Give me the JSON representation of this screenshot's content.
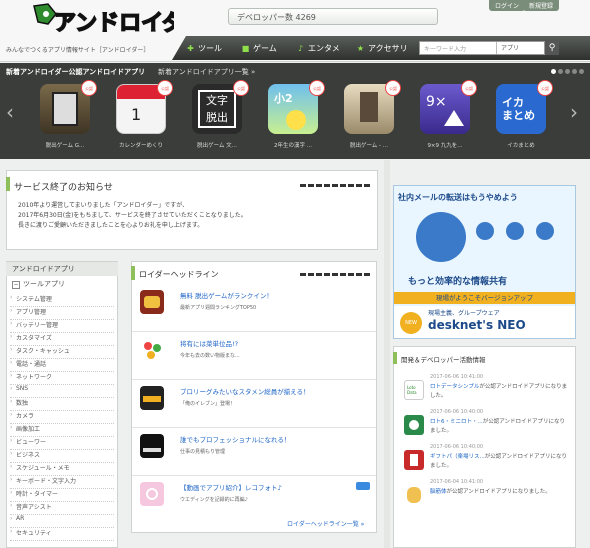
{
  "header": {
    "tagline": "みんなでつくるアプリ情報サイト［アンドロイダー］",
    "developer_count": "デベロッパー数 4269",
    "login": "ログイン",
    "register": "新規登録",
    "nav": [
      {
        "label": "ツール",
        "icon": "wrench-icon"
      },
      {
        "label": "ゲーム",
        "icon": "gamepad-icon"
      },
      {
        "label": "エンタメ",
        "icon": "music-icon"
      },
      {
        "label": "アクセサリ",
        "icon": "star-icon"
      }
    ],
    "search_placeholder": "キーワード入力",
    "search_category": "アプリ"
  },
  "carousel": {
    "title": "新着アンドロイダー公認アンドロイドアプリ",
    "link": "新着アンドロイドアプリ一覧 »",
    "apps": [
      {
        "name": "脱出ゲーム G...",
        "badge": "公認"
      },
      {
        "name": "カレンダーめくり",
        "badge": "公認"
      },
      {
        "name": "脱出ゲーム 文...",
        "badge": "公認"
      },
      {
        "name": "2年生の漢字 ...",
        "badge": "公認"
      },
      {
        "name": "脱出ゲーム - ...",
        "badge": "公認"
      },
      {
        "name": "9×9 九九を...",
        "badge": "公認"
      },
      {
        "name": "イカまとめ",
        "badge": "公認"
      }
    ]
  },
  "notice": {
    "title": "サービス終了のお知らせ",
    "lines": [
      "2010年より運営してまいりました「アンドロイダー」ですが、",
      "2017年6月30日(金)をもちまして、サービスを終了させていただくことなりました。",
      "長きに渡りご愛顧いただきましたことを心よりお礼を申し上げます。"
    ]
  },
  "ad": {
    "line1": "社内メールの転送はもうやめよう",
    "line2": "もっと効率的な情報共有",
    "line3": "現場がようこそバージョンアップ",
    "line4": "現場主義、グループウェア",
    "product": "desknet's NEO",
    "new_badge": "NEW"
  },
  "sidebar": {
    "title": "アンドロイドアプリ",
    "sub": "ツールアプリ",
    "items": [
      "システム管理",
      "アプリ管理",
      "バッテリー管理",
      "カスタマイズ",
      "タスク・キャッシュ",
      "電話・通話",
      "ネットワーク",
      "SNS",
      "数独",
      "カメラ",
      "画像加工",
      "ビューワー",
      "ビジネス",
      "スケジュール・メモ",
      "キーボード・文字入力",
      "時計・タイマー",
      "音声アシスト",
      "AR",
      "セキュリティ"
    ]
  },
  "headline": {
    "title": "ロイダーヘッドライン",
    "items": [
      {
        "title": "無料 脱出ゲームがランクイン！",
        "sub": "最新アプリ週間ランキングTOP50"
      },
      {
        "title": "将有には菜単位品!?",
        "sub": "今年も去の数い物版まな..."
      },
      {
        "title": "ブロリーグみたいなスタメン総員が揃える！",
        "sub": "「俺のイレブン」登場！"
      },
      {
        "title": "誰でもプロフェッショナルになれる！",
        "sub": "仕事の見積もり管理"
      },
      {
        "title": "【動画でアプリ紹介】レコフォト♪",
        "sub": "ウエディングを記録的に再編♪"
      }
    ],
    "more": "ロイダーヘッドライン一覧 »"
  },
  "dev": {
    "title": "開発＆デベロッパー活動情報",
    "items": [
      {
        "date": "2017-06-06 10:41:00",
        "app": "ロトデータシンプル",
        "text": "が公認アンドロイドアプリになりました。"
      },
      {
        "date": "2017-06-06 10:40:00",
        "app": "ロト6・ミニロト・...",
        "text": "が公認アンドロイドアプリになりました。"
      },
      {
        "date": "2017-06-06 10:40:00",
        "app": "ギフトパ（楽場リス...",
        "text": "が公認アンドロイドアプリになりました。"
      },
      {
        "date": "2017-06-04 10:41:00",
        "app": "脳筋体",
        "text": "が公認アンドロイドアプリになりました。"
      }
    ]
  },
  "colors": {
    "accent_green": "#8fe04a",
    "link": "#1c64c6",
    "badge_red": "#e44444"
  }
}
